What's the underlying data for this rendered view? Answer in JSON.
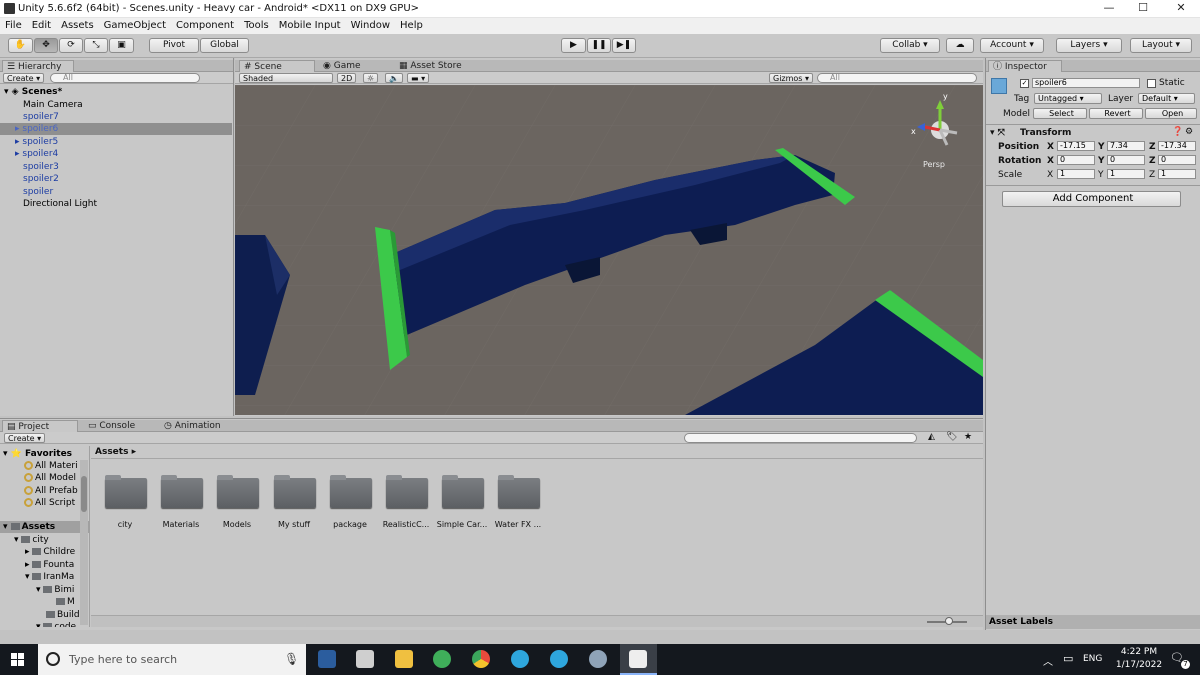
{
  "window": {
    "title": "Unity 5.6.6f2 (64bit) - Scenes.unity - Heavy car - Android* <DX11 on DX9 GPU>",
    "min": "—",
    "max": "☐",
    "close": "✕"
  },
  "menu": [
    "File",
    "Edit",
    "Assets",
    "GameObject",
    "Component",
    "Tools",
    "Mobile Input",
    "Window",
    "Help"
  ],
  "toolbar": {
    "pivot": "Pivot",
    "global": "Global",
    "collab": "Collab ▾",
    "account": "Account",
    "layers": "Layers",
    "layout": "Layout"
  },
  "hierarchy": {
    "tab": "Hierarchy",
    "create": "Create ▾",
    "search_placeholder": "All",
    "scene": "Scenes*",
    "items": [
      {
        "label": "Main Camera"
      },
      {
        "label": "spoiler7"
      },
      {
        "label": "spoiler6"
      },
      {
        "label": "spoiler5"
      },
      {
        "label": "spoiler4"
      },
      {
        "label": "spoiler3"
      },
      {
        "label": "spoiler2"
      },
      {
        "label": "spoiler"
      },
      {
        "label": "Directional Light"
      }
    ]
  },
  "scene": {
    "tab_scene": "Scene",
    "tab_game": "Game",
    "tab_store": "Asset Store",
    "shaded": "Shaded",
    "mode2d": "2D",
    "gizmos": "Gizmos ▾",
    "search_placeholder": "All",
    "persp": "Persp",
    "gizmo_y": "y",
    "gizmo_x": "x"
  },
  "inspector": {
    "tab": "Inspector",
    "name": "spoiler6",
    "static": "Static",
    "tag_label": "Tag",
    "tag": "Untagged",
    "layer_label": "Layer",
    "layer": "Default",
    "model_label": "Model",
    "select": "Select",
    "revert": "Revert",
    "open": "Open",
    "transform": "Transform",
    "position_label": "Position",
    "rotation_label": "Rotation",
    "scale_label": "Scale",
    "axis_x": "X",
    "axis_y": "Y",
    "axis_z": "Z",
    "position": {
      "x": "-17.15",
      "y": "7.34",
      "z": "-17.34"
    },
    "rotation": {
      "x": "0",
      "y": "0",
      "z": "0"
    },
    "scale": {
      "x": "1",
      "y": "1",
      "z": "1"
    },
    "add_component": "Add Component",
    "asset_labels": "Asset Labels"
  },
  "project": {
    "tab_project": "Project",
    "tab_console": "Console",
    "tab_animation": "Animation",
    "create": "Create ▾",
    "breadcrumb": "Assets",
    "favorites": "Favorites",
    "fav_items": [
      "All Materi",
      "All Model",
      "All Prefab",
      "All Script"
    ],
    "assets_root": "Assets",
    "tree": [
      "city",
      "Childre",
      "Founta",
      "IranMa",
      "Bimi",
      "M",
      "Build",
      "code"
    ],
    "folders": [
      "city",
      "Materials",
      "Models",
      "My stuff",
      "package",
      "RealisticC...",
      "Simple Car...",
      "Water FX ..."
    ]
  },
  "taskbar": {
    "search_placeholder": "Type here to search",
    "lang": "ENG",
    "time": "4:22 PM",
    "date": "1/17/2022",
    "notif": "7"
  }
}
